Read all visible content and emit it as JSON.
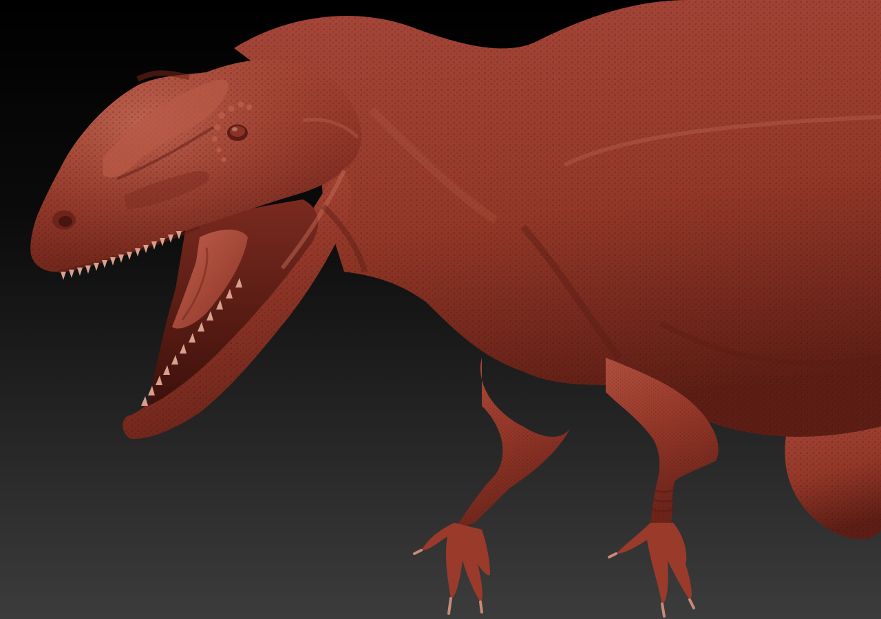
{
  "scene": {
    "subject": "sculpted-theropod-dinosaur",
    "material_color": "#9e3a2c",
    "material_highlight": "#c46a55",
    "material_shadow": "#5a1c14",
    "tooth_color": "#d9a08e",
    "background_top": "#000000",
    "background_bottom": "#3c3c3c"
  }
}
